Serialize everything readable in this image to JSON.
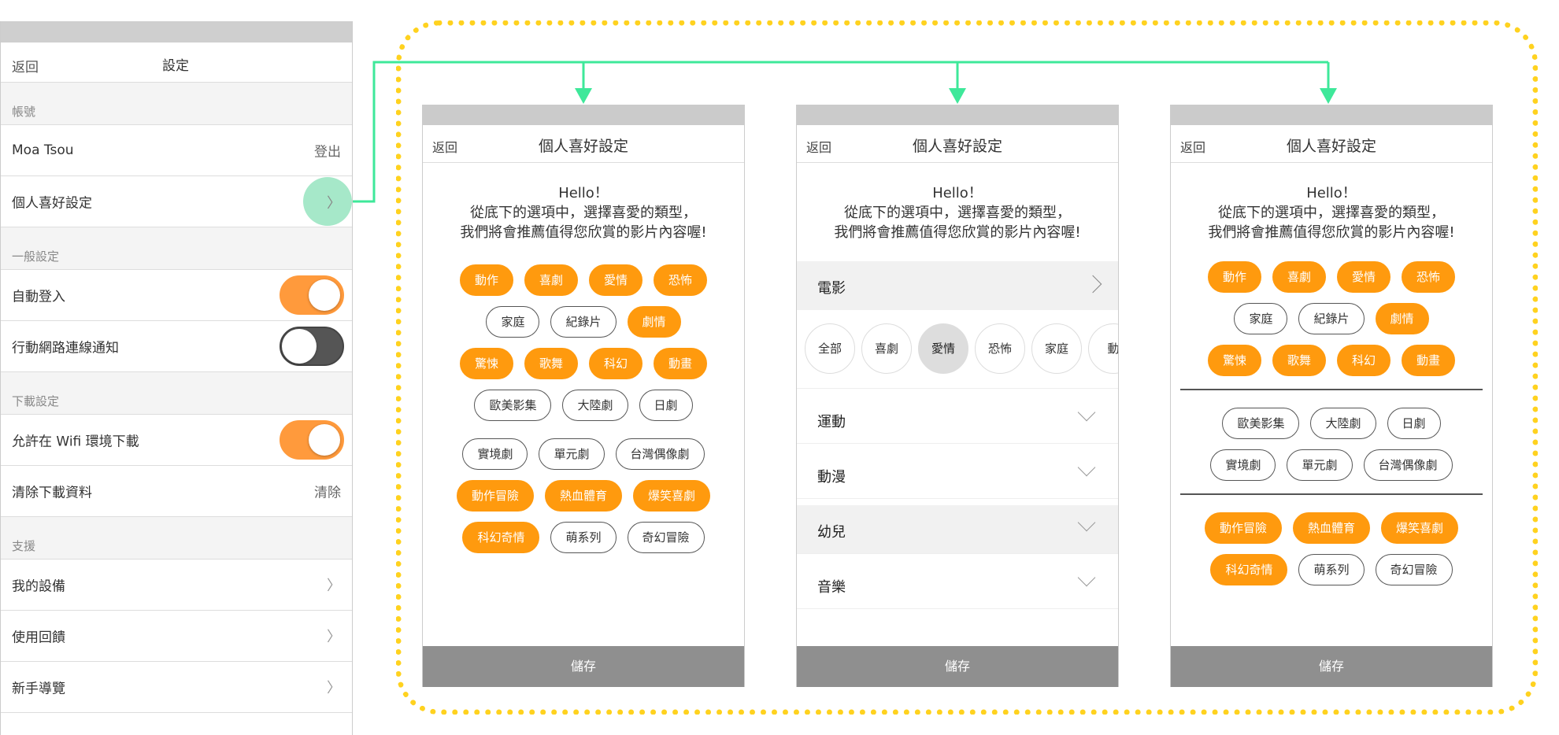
{
  "settings": {
    "back_label": "返回",
    "title": "設定",
    "sections": [
      {
        "header": "帳號",
        "rows": [
          {
            "label": "Moa Tsou",
            "value": "登出"
          },
          {
            "label": "個人喜好設定",
            "chevron": "〉"
          }
        ]
      },
      {
        "header": "一般設定",
        "rows": [
          {
            "label": "自動登入",
            "toggle": "on"
          },
          {
            "label": "行動網路連線通知",
            "toggle": "off"
          }
        ]
      },
      {
        "header": "下載設定",
        "rows": [
          {
            "label": "允許在 Wifi 環境下載",
            "toggle": "on"
          },
          {
            "label": "清除下載資料",
            "value": "清除"
          }
        ]
      },
      {
        "header": "支援",
        "rows": [
          {
            "label": "我的設備",
            "chevron": "〉"
          },
          {
            "label": "使用回饋",
            "chevron": "〉"
          },
          {
            "label": "新手導覽",
            "chevron": "〉"
          }
        ]
      }
    ]
  },
  "colors": {
    "accent": "#ff9a0e",
    "toggle_on": "#ff9a3c",
    "toggle_off": "#555555",
    "connector": "#3ee89a",
    "tap_marker": "#a6e8c9",
    "dotted_border": "#ffd21f",
    "save_bar": "#8f8f8f"
  },
  "phones": [
    {
      "back_label": "返回",
      "title": "個人喜好設定",
      "greeting": [
        "Hello！",
        "從底下的選項中，選擇喜愛的類型，",
        "我們將會推薦值得您欣賞的影片內容喔!"
      ],
      "tag_rows": [
        [
          {
            "label": "動作",
            "selected": true
          },
          {
            "label": "喜劇",
            "selected": true
          },
          {
            "label": "愛情",
            "selected": true
          },
          {
            "label": "恐怖",
            "selected": true
          }
        ],
        [
          {
            "label": "家庭",
            "selected": false
          },
          {
            "label": "紀錄片",
            "selected": false
          },
          {
            "label": "劇情",
            "selected": true
          }
        ],
        [
          {
            "label": "驚悚",
            "selected": true
          },
          {
            "label": "歌舞",
            "selected": true
          },
          {
            "label": "科幻",
            "selected": true
          },
          {
            "label": "動畫",
            "selected": true
          }
        ],
        [
          {
            "label": "歐美影集",
            "selected": false
          },
          {
            "label": "大陸劇",
            "selected": false
          },
          {
            "label": "日劇",
            "selected": false
          }
        ],
        [
          {
            "label": "實境劇",
            "selected": false
          },
          {
            "label": "單元劇",
            "selected": false
          },
          {
            "label": "台灣偶像劇",
            "selected": false
          }
        ],
        [
          {
            "label": "動作冒險",
            "selected": true
          },
          {
            "label": "熱血體育",
            "selected": true
          },
          {
            "label": "爆笑喜劇",
            "selected": true
          }
        ],
        [
          {
            "label": "科幻奇情",
            "selected": true
          },
          {
            "label": "萌系列",
            "selected": false
          },
          {
            "label": "奇幻冒險",
            "selected": false
          }
        ]
      ],
      "save_label": "儲存"
    },
    {
      "back_label": "返回",
      "title": "個人喜好設定",
      "greeting": [
        "Hello！",
        "從底下的選項中，選擇喜愛的類型，",
        "我們將會推薦值得您欣賞的影片內容喔!"
      ],
      "expanded_category": "電影",
      "sub_options": [
        {
          "label": "全部",
          "active": false
        },
        {
          "label": "喜劇",
          "active": false
        },
        {
          "label": "愛情",
          "active": true
        },
        {
          "label": "恐怖",
          "active": false
        },
        {
          "label": "家庭",
          "active": false
        },
        {
          "label": "動",
          "active": false
        }
      ],
      "collapsed_categories": [
        {
          "label": "運動",
          "shaded": false
        },
        {
          "label": "動漫",
          "shaded": false
        },
        {
          "label": "幼兒",
          "shaded": true
        },
        {
          "label": "音樂",
          "shaded": false
        }
      ],
      "save_label": "儲存"
    },
    {
      "back_label": "返回",
      "title": "個人喜好設定",
      "greeting": [
        "Hello！",
        "從底下的選項中，選擇喜愛的類型，",
        "我們將會推薦值得您欣賞的影片內容喔!"
      ],
      "groups": [
        [
          [
            {
              "label": "動作",
              "selected": true
            },
            {
              "label": "喜劇",
              "selected": true
            },
            {
              "label": "愛情",
              "selected": true
            },
            {
              "label": "恐怖",
              "selected": true
            }
          ],
          [
            {
              "label": "家庭",
              "selected": false
            },
            {
              "label": "紀錄片",
              "selected": false
            },
            {
              "label": "劇情",
              "selected": true
            }
          ],
          [
            {
              "label": "驚悚",
              "selected": true
            },
            {
              "label": "歌舞",
              "selected": true
            },
            {
              "label": "科幻",
              "selected": true
            },
            {
              "label": "動畫",
              "selected": true
            }
          ]
        ],
        [
          [
            {
              "label": "歐美影集",
              "selected": false
            },
            {
              "label": "大陸劇",
              "selected": false
            },
            {
              "label": "日劇",
              "selected": false
            }
          ],
          [
            {
              "label": "實境劇",
              "selected": false
            },
            {
              "label": "單元劇",
              "selected": false
            },
            {
              "label": "台灣偶像劇",
              "selected": false
            }
          ]
        ],
        [
          [
            {
              "label": "動作冒險",
              "selected": true
            },
            {
              "label": "熱血體育",
              "selected": true
            },
            {
              "label": "爆笑喜劇",
              "selected": true
            }
          ],
          [
            {
              "label": "科幻奇情",
              "selected": true
            },
            {
              "label": "萌系列",
              "selected": false
            },
            {
              "label": "奇幻冒險",
              "selected": false
            }
          ]
        ]
      ],
      "save_label": "儲存"
    }
  ]
}
